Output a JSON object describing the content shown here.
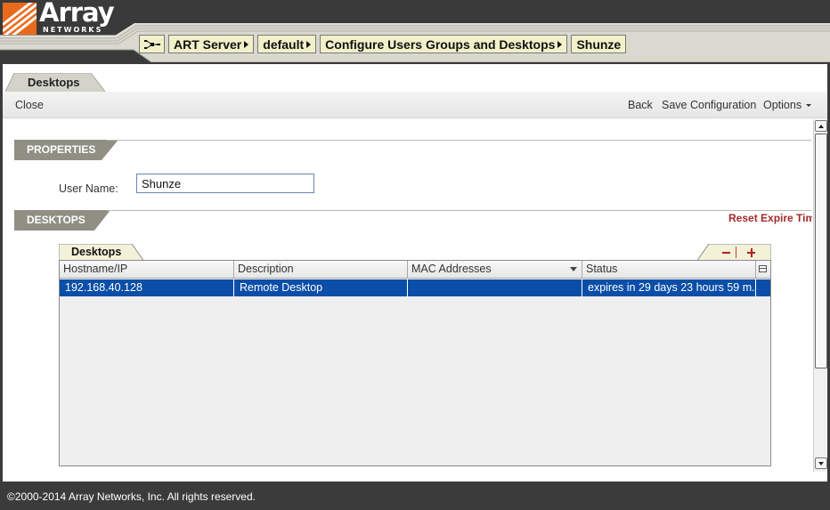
{
  "brand": {
    "name": "Array",
    "sub": "NETWORKS",
    "accent_color": "#e86a1c"
  },
  "breadcrumb": {
    "network_icon": "network-tree-icon",
    "items": [
      {
        "label": "ART Server"
      },
      {
        "label": "default"
      },
      {
        "label": "Configure Users Groups and Desktops"
      },
      {
        "label": "Shunze"
      }
    ]
  },
  "main_tab": {
    "label": "Desktops"
  },
  "toolbar": {
    "close_label": "Close",
    "back_label": "Back",
    "save_label": "Save Configuration",
    "options_label": "Options"
  },
  "properties": {
    "title": "PROPERTIES",
    "username_label": "User Name:",
    "username_value": "Shunze"
  },
  "desktops": {
    "title": "DESKTOPS",
    "reset_link": "Reset Expire Tim",
    "grid_tab": "Desktops",
    "columns": [
      "Hostname/IP",
      "Description",
      "MAC Addresses",
      "Status"
    ],
    "rows": [
      {
        "hostname": "192.168.40.128",
        "description": "Remote Desktop",
        "mac": "",
        "status": "expires in 29 days 23 hours 59 m..."
      }
    ],
    "selected_row_color": "#0a4ea8"
  },
  "footer": {
    "copyright": "©2000-2014 Array Networks, Inc. All rights reserved."
  }
}
